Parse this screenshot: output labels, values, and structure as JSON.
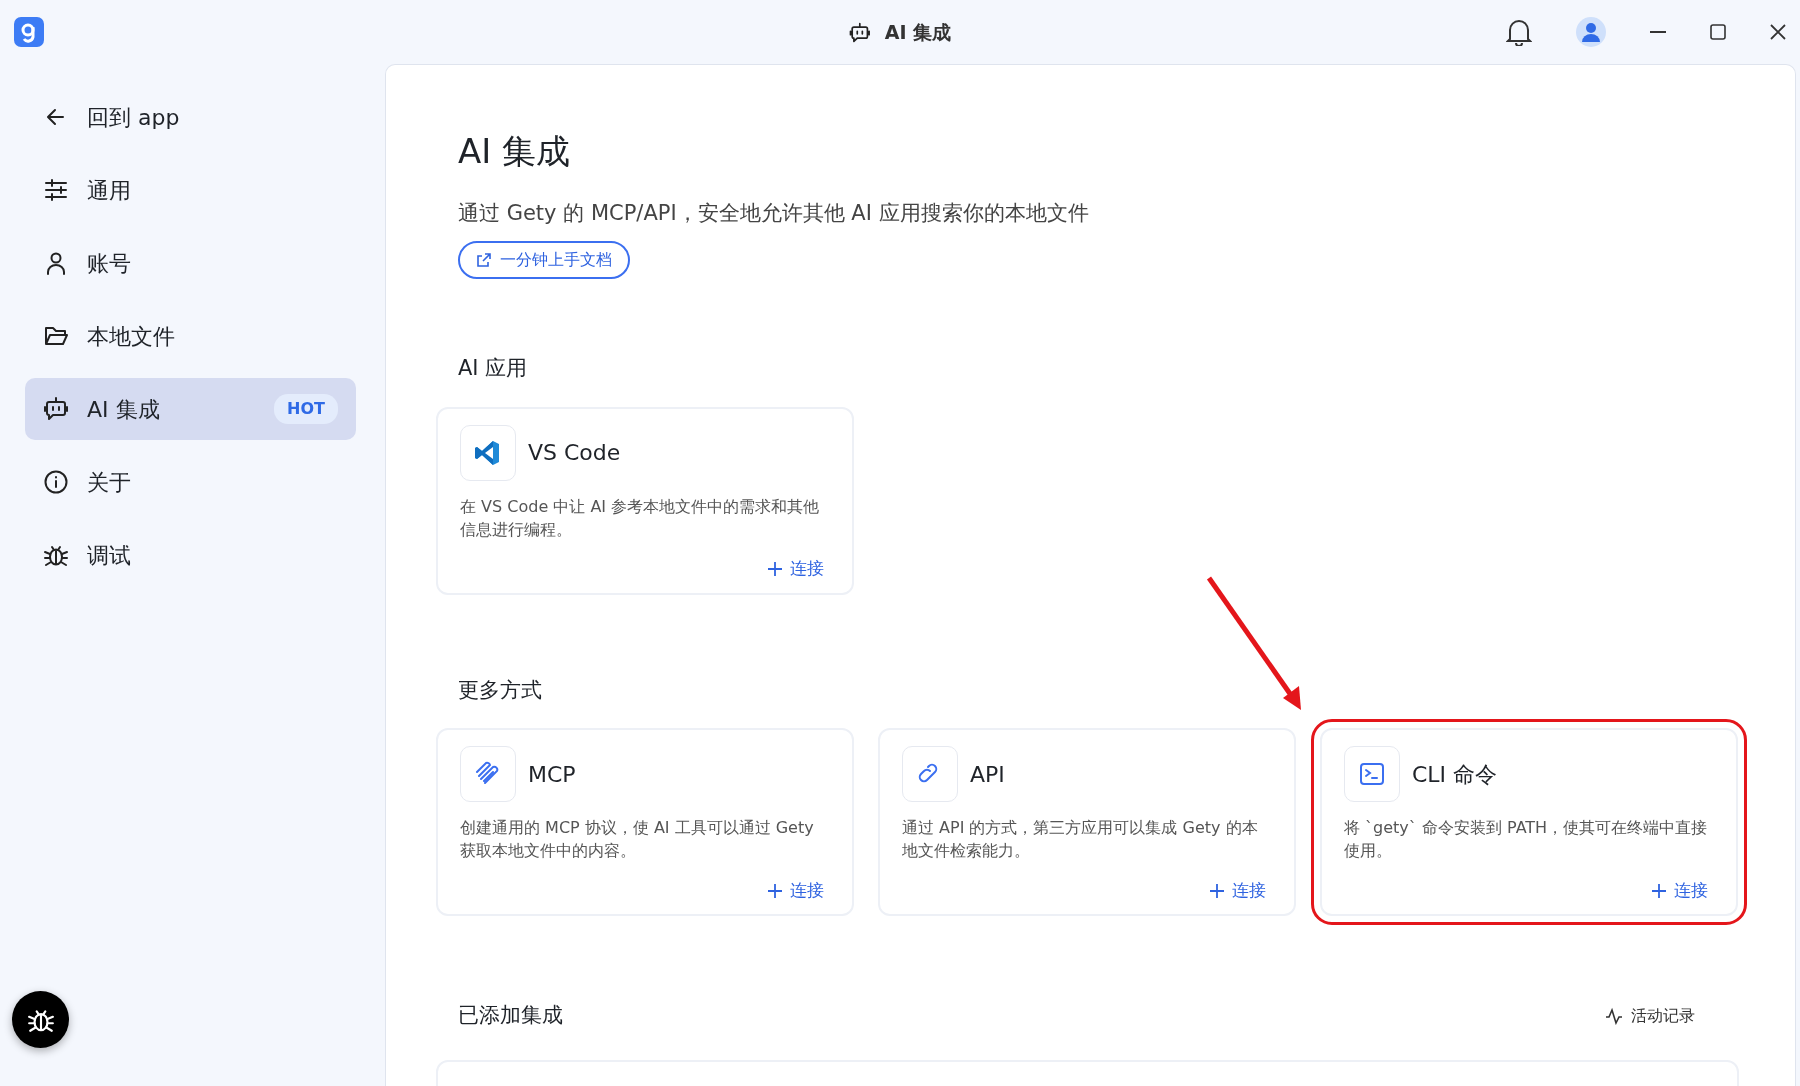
{
  "window": {
    "title": "AI 集成"
  },
  "sidebar": {
    "back": {
      "label": "回到 app"
    },
    "items": [
      {
        "label": "通用",
        "selected": false
      },
      {
        "label": "账号",
        "selected": false
      },
      {
        "label": "本地文件",
        "selected": false
      },
      {
        "label": "AI 集成",
        "selected": true,
        "badge": "HOT"
      },
      {
        "label": "关于",
        "selected": false
      },
      {
        "label": "调试",
        "selected": false
      }
    ]
  },
  "page": {
    "title": "AI 集成",
    "subtitle": "通过 Gety 的 MCP/API，安全地允许其他 AI 应用搜索你的本地文件",
    "doc_link": "一分钟上手文档"
  },
  "sections": [
    {
      "title": "AI 应用",
      "cards": [
        {
          "title": "VS Code",
          "description": "在 VS Code 中让 AI 参考本地文件中的需求和其他信息进行编程。",
          "action": "连接",
          "highlighted": false
        }
      ]
    },
    {
      "title": "更多方式",
      "cards": [
        {
          "title": "MCP",
          "description": "创建通用的 MCP 协议，使 AI 工具可以通过 Gety 获取本地文件中的内容。",
          "action": "连接",
          "highlighted": false
        },
        {
          "title": "API",
          "description": "通过 API 的方式，第三方应用可以集成 Gety 的本地文件检索能力。",
          "action": "连接",
          "highlighted": false
        },
        {
          "title": "CLI 命令",
          "description": "将 `gety` 命令安装到 PATH，使其可在终端中直接使用。",
          "action": "连接",
          "highlighted": true
        }
      ]
    }
  ],
  "added": {
    "title": "已添加集成",
    "activity_link": "活动记录"
  }
}
